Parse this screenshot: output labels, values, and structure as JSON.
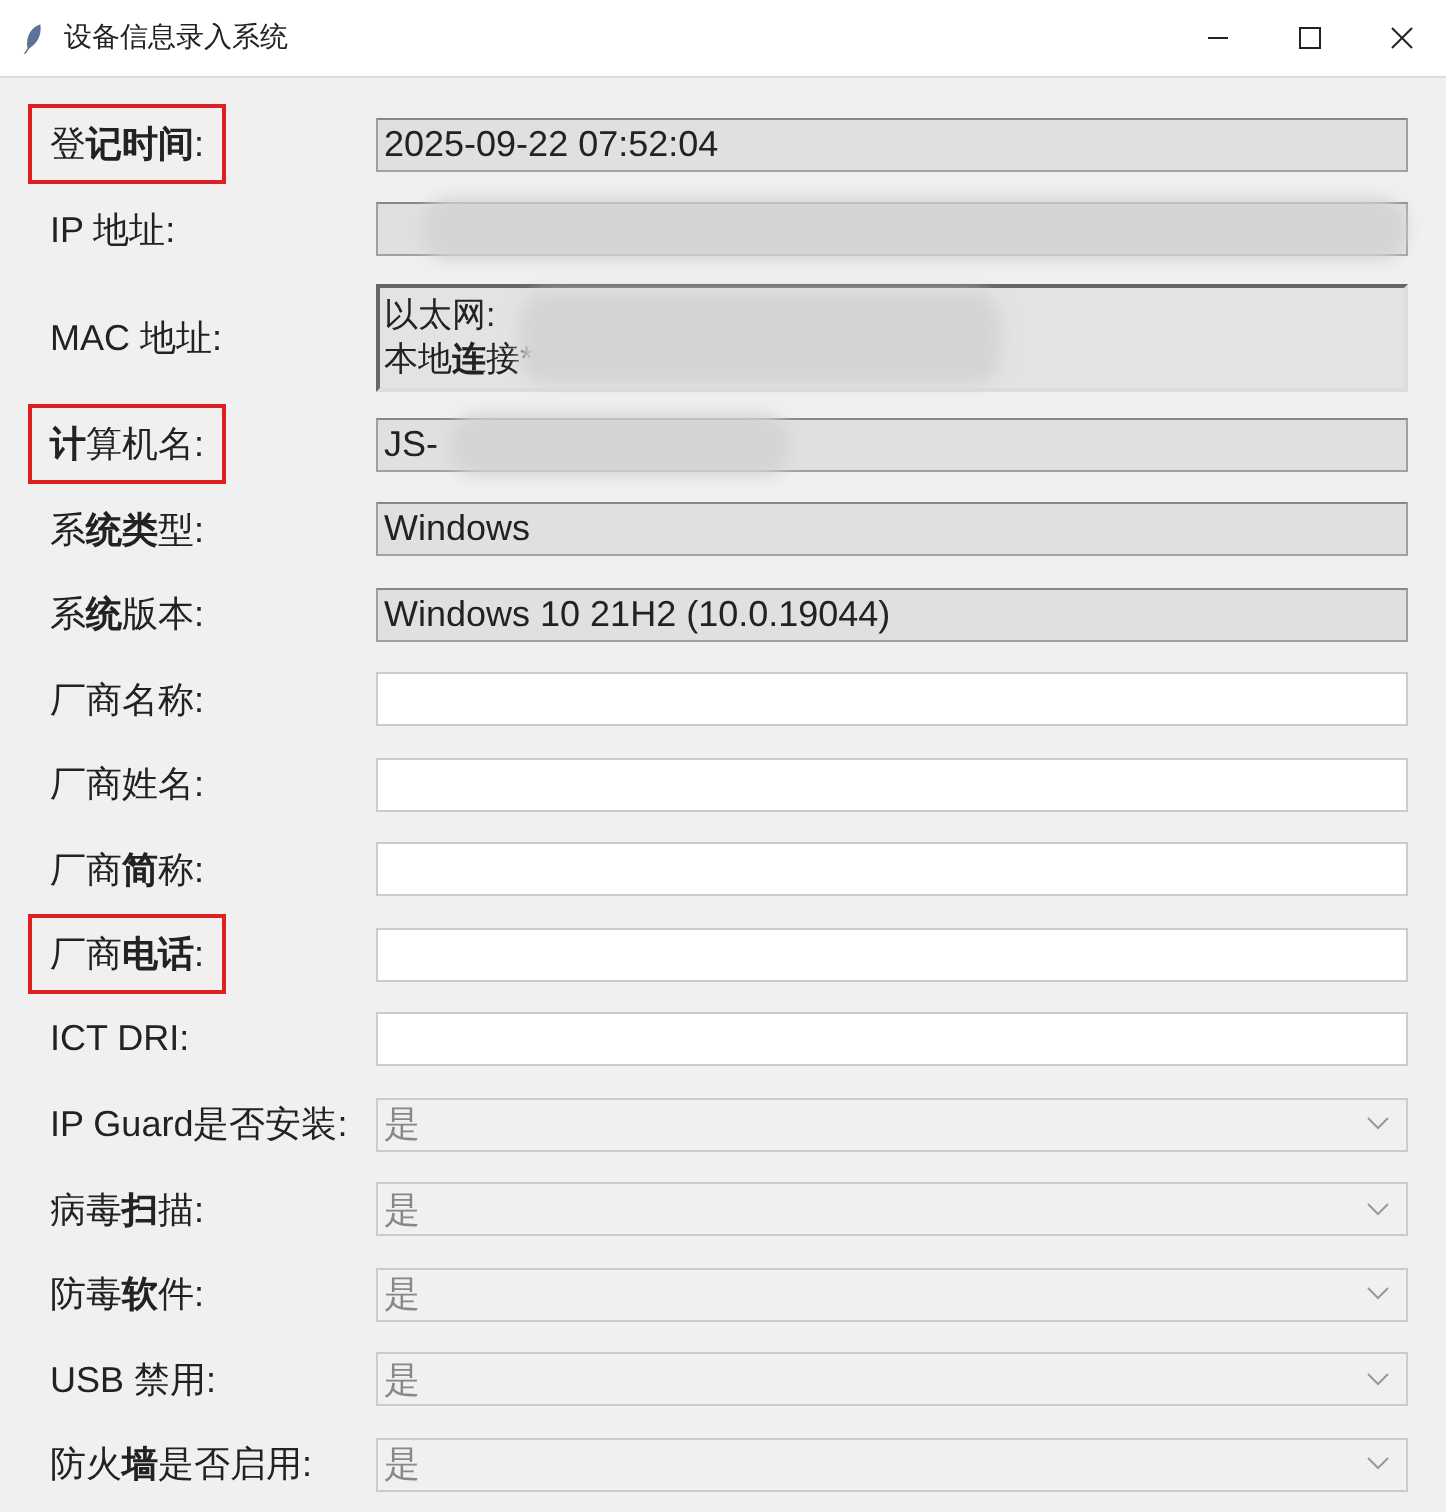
{
  "window": {
    "title": "设备信息录入系统"
  },
  "rows": [
    {
      "label": "登**记时间**:",
      "highlight": true,
      "kind": "readonly",
      "value": "2025-09-22 07:52:04",
      "redacted": false
    },
    {
      "label": "IP 地址:",
      "highlight": false,
      "kind": "readonly",
      "redacted": true
    },
    {
      "label": "MAC 地址:",
      "highlight": false,
      "kind": "text",
      "lines": [
        "以太网:",
        "本地**连**接*"
      ],
      "redacted": true
    },
    {
      "label": "**计**算机名:",
      "highlight": true,
      "kind": "readonly",
      "value": "JS-",
      "redacted": true
    },
    {
      "label": "系**统类**型:",
      "highlight": false,
      "kind": "readonly",
      "value": "Windows",
      "redacted": false
    },
    {
      "label": "系**统**版本:",
      "highlight": false,
      "kind": "readonly",
      "value": "Windows 10 21H2 (10.0.19044)",
      "redacted": false
    },
    {
      "label": "厂商名称:",
      "highlight": false,
      "kind": "entry"
    },
    {
      "label": "厂商姓名:",
      "highlight": false,
      "kind": "entry"
    },
    {
      "label": "厂商**简**称:",
      "highlight": false,
      "kind": "entry"
    },
    {
      "label": "厂商**电话**:",
      "highlight": true,
      "kind": "entry"
    },
    {
      "label": "ICT DRI:",
      "highlight": false,
      "kind": "entry"
    },
    {
      "label": "IP Guard是否安装:",
      "highlight": false,
      "kind": "combo",
      "value": "是"
    },
    {
      "label": "病毒**扫**描:",
      "highlight": false,
      "kind": "combo",
      "value": "是"
    },
    {
      "label": "防毒**软**件:",
      "highlight": false,
      "kind": "combo",
      "value": "是"
    },
    {
      "label": "USB 禁用:",
      "highlight": false,
      "kind": "combo",
      "value": "是"
    },
    {
      "label": "防火**墙**是否启用:",
      "highlight": false,
      "kind": "combo",
      "value": "是"
    }
  ]
}
